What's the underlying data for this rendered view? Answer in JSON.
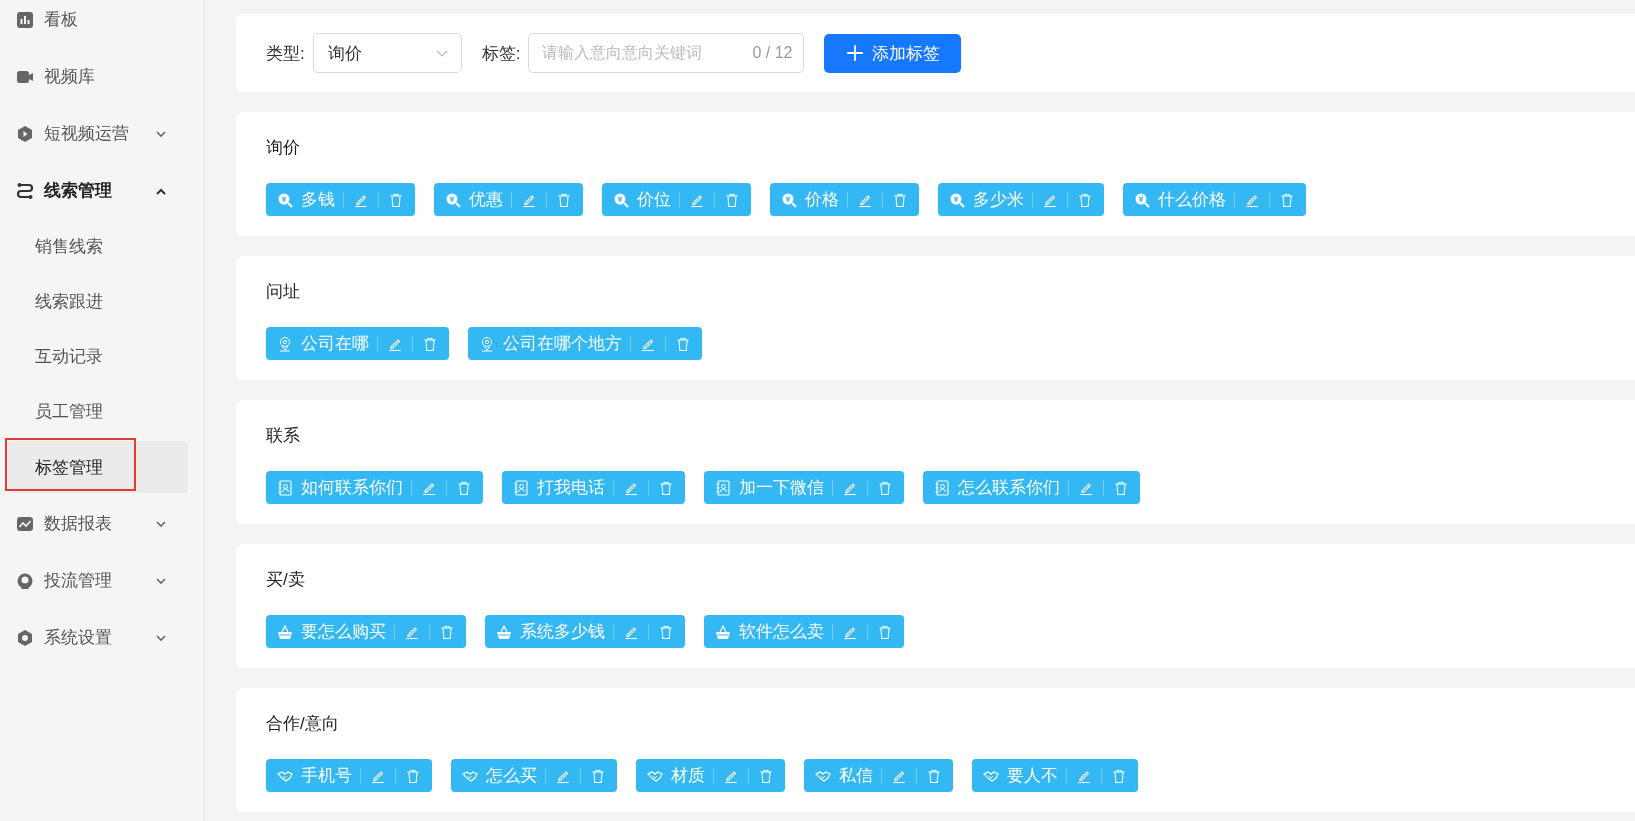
{
  "sidebar": {
    "items": [
      {
        "label": "看板",
        "expandable": false,
        "active": false
      },
      {
        "label": "视频库",
        "expandable": false,
        "active": false
      },
      {
        "label": "短视频运营",
        "expandable": true,
        "expanded": false,
        "active": false
      },
      {
        "label": "线索管理",
        "expandable": true,
        "expanded": true,
        "active": true,
        "children": [
          {
            "label": "销售线索",
            "selected": false,
            "highlighted": false
          },
          {
            "label": "线索跟进",
            "selected": false,
            "highlighted": false
          },
          {
            "label": "互动记录",
            "selected": false,
            "highlighted": false
          },
          {
            "label": "员工管理",
            "selected": false,
            "highlighted": false
          },
          {
            "label": "标签管理",
            "selected": true,
            "highlighted": true
          }
        ]
      },
      {
        "label": "数据报表",
        "expandable": true,
        "expanded": false,
        "active": false
      },
      {
        "label": "投流管理",
        "expandable": true,
        "expanded": false,
        "active": false
      },
      {
        "label": "系统设置",
        "expandable": true,
        "expanded": false,
        "active": false
      }
    ]
  },
  "toolbar": {
    "type_label": "类型:",
    "type_value": "询价",
    "tag_label": "标签:",
    "tag_placeholder": "请输入意向意向关键词",
    "counter": "0 / 12",
    "add_button": "添加标签"
  },
  "sections": [
    {
      "title": "询价",
      "tags": [
        "多钱",
        "优惠",
        "价位",
        "价格",
        "多少米",
        "什么价格"
      ]
    },
    {
      "title": "问址",
      "tags": [
        "公司在哪",
        "公司在哪个地方"
      ]
    },
    {
      "title": "联系",
      "tags": [
        "如何联系你们",
        "打我电话",
        "加一下微信",
        "怎么联系你们"
      ]
    },
    {
      "title": "买/卖",
      "tags": [
        "要怎么购买",
        "系统多少钱",
        "软件怎么卖"
      ]
    },
    {
      "title": "合作/意向",
      "tags": [
        "手机号",
        "怎么买",
        "材质",
        "私信",
        "要人不"
      ]
    }
  ]
}
